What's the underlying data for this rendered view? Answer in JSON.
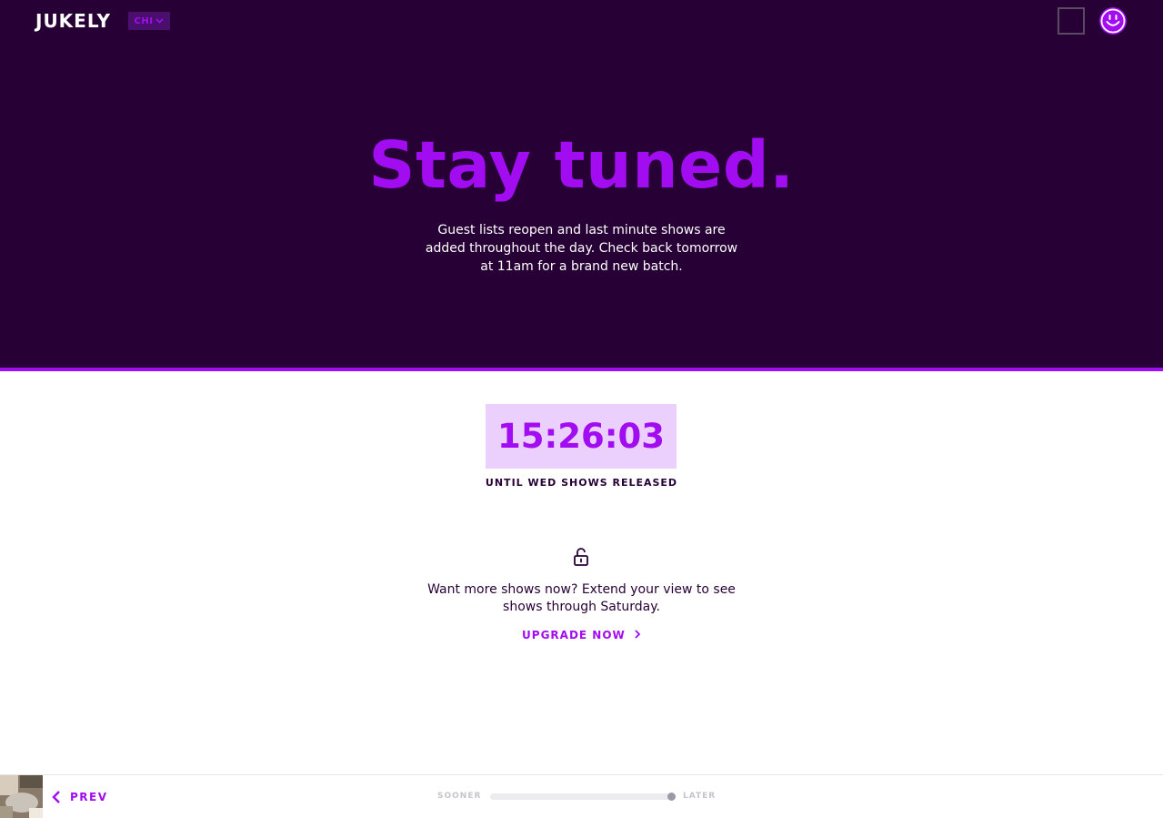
{
  "header": {
    "logo": "JUKELY",
    "city": "CHI"
  },
  "hero": {
    "title": "Stay tuned.",
    "text": "Guest lists reopen and last minute shows are added throughout the day. Check back tomorrow at 11am for a brand new batch."
  },
  "countdown": {
    "time": "15:26:03",
    "label": "UNTIL WED SHOWS RELEASED"
  },
  "upgrade": {
    "text": "Want more shows now? Extend your view to see shows through Saturday.",
    "link": "UPGRADE NOW"
  },
  "footer": {
    "prev_label": "PREV",
    "sooner_label": "SOONER",
    "later_label": "LATER",
    "timeline_position": 1.0
  },
  "colors": {
    "background_dark": "#270036",
    "accent": "#a10cf0",
    "countdown_bg": "#ebd0fd"
  },
  "icons": {
    "city_dropdown": "chevron-down-icon",
    "profile": "smiley-icon",
    "upgrade": "unlock-icon",
    "prev": "chevron-left-icon",
    "upgrade_link": "chevron-right-icon"
  }
}
